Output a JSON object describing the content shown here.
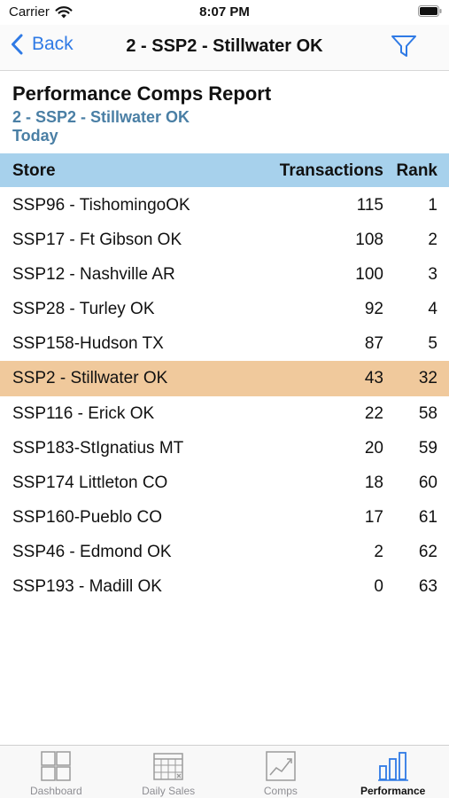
{
  "status_bar": {
    "carrier": "Carrier",
    "time": "8:07 PM"
  },
  "nav": {
    "back_label": "Back",
    "title": "2 - SSP2 - Stillwater OK"
  },
  "report": {
    "title": "Performance Comps Report",
    "store": "2 - SSP2 - Stillwater OK",
    "period": "Today"
  },
  "table": {
    "columns": {
      "store": "Store",
      "transactions": "Transactions",
      "rank": "Rank"
    },
    "rows": [
      {
        "store": "SSP96 - TishomingoOK",
        "transactions": "115",
        "rank": "1"
      },
      {
        "store": "SSP17 - Ft Gibson OK",
        "transactions": "108",
        "rank": "2"
      },
      {
        "store": "SSP12 - Nashville AR",
        "transactions": "100",
        "rank": "3"
      },
      {
        "store": "SSP28 - Turley OK",
        "transactions": "92",
        "rank": "4"
      },
      {
        "store": "SSP158-Hudson TX",
        "transactions": "87",
        "rank": "5"
      },
      {
        "store": "SSP2 - Stillwater OK",
        "transactions": "43",
        "rank": "32",
        "highlight": true
      },
      {
        "store": "SSP116 - Erick OK",
        "transactions": "22",
        "rank": "58"
      },
      {
        "store": "SSP183-StIgnatius MT",
        "transactions": "20",
        "rank": "59"
      },
      {
        "store": "SSP174 Littleton CO",
        "transactions": "18",
        "rank": "60"
      },
      {
        "store": "SSP160-Pueblo CO",
        "transactions": "17",
        "rank": "61"
      },
      {
        "store": "SSP46 - Edmond OK",
        "transactions": "2",
        "rank": "62"
      },
      {
        "store": "SSP193 - Madill OK",
        "transactions": "0",
        "rank": "63"
      }
    ]
  },
  "tabs": [
    {
      "label": "Dashboard",
      "icon": "dashboard-icon",
      "active": false
    },
    {
      "label": "Daily Sales",
      "icon": "calendar-icon",
      "active": false
    },
    {
      "label": "Comps",
      "icon": "line-chart-icon",
      "active": false
    },
    {
      "label": "Performance",
      "icon": "bar-chart-icon",
      "active": true
    }
  ],
  "colors": {
    "accent": "#2f7ae5",
    "table_header_bg": "#a7d1ec",
    "highlight_row_bg": "#f0c99c",
    "subtitle": "#4a7fa5"
  }
}
